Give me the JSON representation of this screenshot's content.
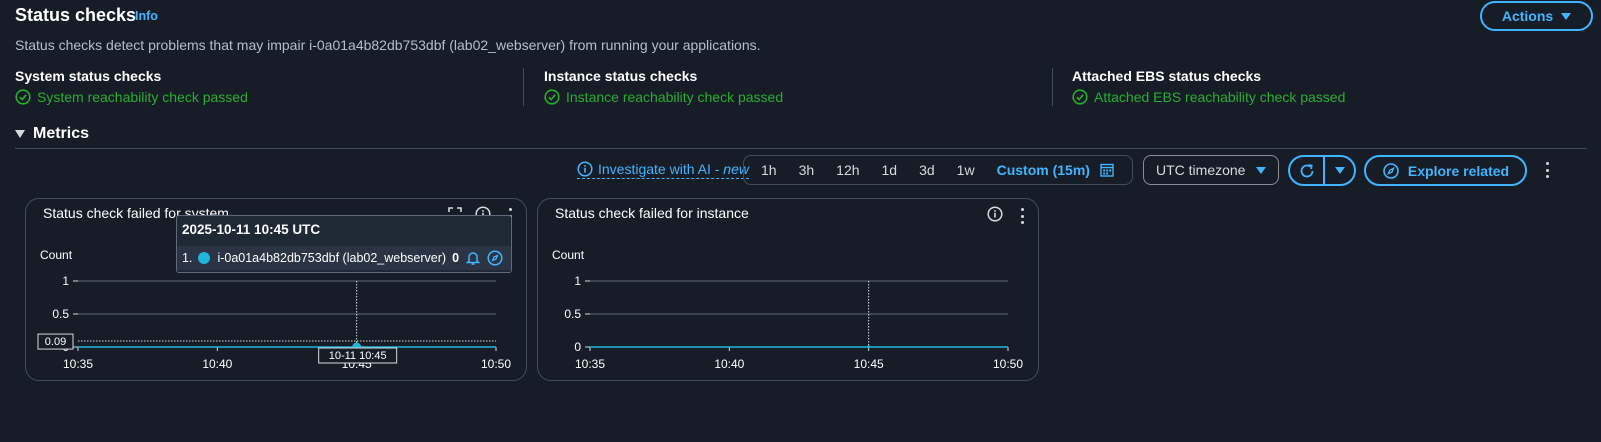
{
  "header": {
    "title": "Status checks",
    "info_label": "Info",
    "actions_label": "Actions",
    "description": "Status checks detect problems that may impair i-0a01a4b82db753dbf (lab02_webserver) from running your applications."
  },
  "checks": [
    {
      "title": "System status checks",
      "status": "System reachability check passed"
    },
    {
      "title": "Instance status checks",
      "status": "Instance reachability check passed"
    },
    {
      "title": "Attached EBS status checks",
      "status": "Attached EBS reachability check passed"
    }
  ],
  "colors": {
    "accent": "#42b4ff",
    "success": "#29ad32",
    "background": "#161d26",
    "series": "#1fb6d9"
  },
  "metrics": {
    "heading": "Metrics",
    "investigate_label": "Investigate with AI - ",
    "investigate_new": "new",
    "time_ranges": [
      "1h",
      "3h",
      "12h",
      "1d",
      "3d",
      "1w"
    ],
    "custom_range_label": "Custom (15m)",
    "timezone": "UTC timezone",
    "explore_label": "Explore related"
  },
  "widgets": [
    {
      "title": "Status check failed for system",
      "y_label": "Count"
    },
    {
      "title": "Status check failed for instance",
      "y_label": "Count"
    }
  ],
  "tooltip": {
    "timestamp": "2025-10-11 10:45 UTC",
    "row_index": "1.",
    "instance_label": "i-0a01a4b82db753dbf (lab02_webserver)",
    "value": "0"
  },
  "chart_data": [
    {
      "type": "line",
      "title": "Status check failed for system",
      "ylabel": "Count",
      "x": [
        "10:35",
        "10:40",
        "10:45",
        "10:50"
      ],
      "x_ticks": [
        "10:35",
        "10:40",
        "10:45",
        "10:50"
      ],
      "y_ticks": [
        "0",
        "0.5",
        "1"
      ],
      "ylim": [
        0,
        1
      ],
      "hover_x_label": "10-11 10:45",
      "hover_y_label": "0.09",
      "series": [
        {
          "name": "i-0a01a4b82db753dbf (lab02_webserver)",
          "values": [
            0,
            0,
            0,
            0
          ]
        }
      ],
      "grid": true
    },
    {
      "type": "line",
      "title": "Status check failed for instance",
      "ylabel": "Count",
      "x": [
        "10:35",
        "10:40",
        "10:45",
        "10:50"
      ],
      "x_ticks": [
        "10:35",
        "10:40",
        "10:45",
        "10:50"
      ],
      "y_ticks": [
        "0",
        "0.5",
        "1"
      ],
      "ylim": [
        0,
        1
      ],
      "series": [
        {
          "name": "i-0a01a4b82db753dbf (lab02_webserver)",
          "values": [
            0,
            0,
            0,
            0
          ]
        }
      ],
      "grid": true
    }
  ]
}
